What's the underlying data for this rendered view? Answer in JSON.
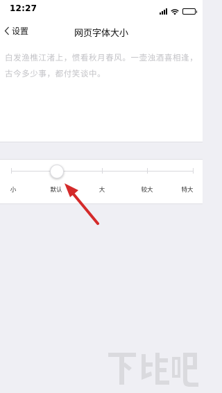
{
  "status_bar": {
    "time": "12:27",
    "icons": [
      "signal-icon",
      "wifi-icon",
      "battery-icon"
    ]
  },
  "nav": {
    "back_label": "设置",
    "title": "网页字体大小"
  },
  "preview": {
    "text": "白发渔樵江渚上，惯看秋月春风。一壶浊酒喜相逢，古今多少事，都付笑谈中。"
  },
  "font_size_slider": {
    "options": [
      "小",
      "默认",
      "大",
      "较大",
      "特大"
    ],
    "selected": "默认",
    "selected_index": 1
  },
  "colors": {
    "background": "#efeff4",
    "panel": "#ffffff",
    "preview_text": "#c3c3c7",
    "annotation_arrow": "#d42a2a"
  },
  "watermark": {
    "text": "下载吧"
  }
}
